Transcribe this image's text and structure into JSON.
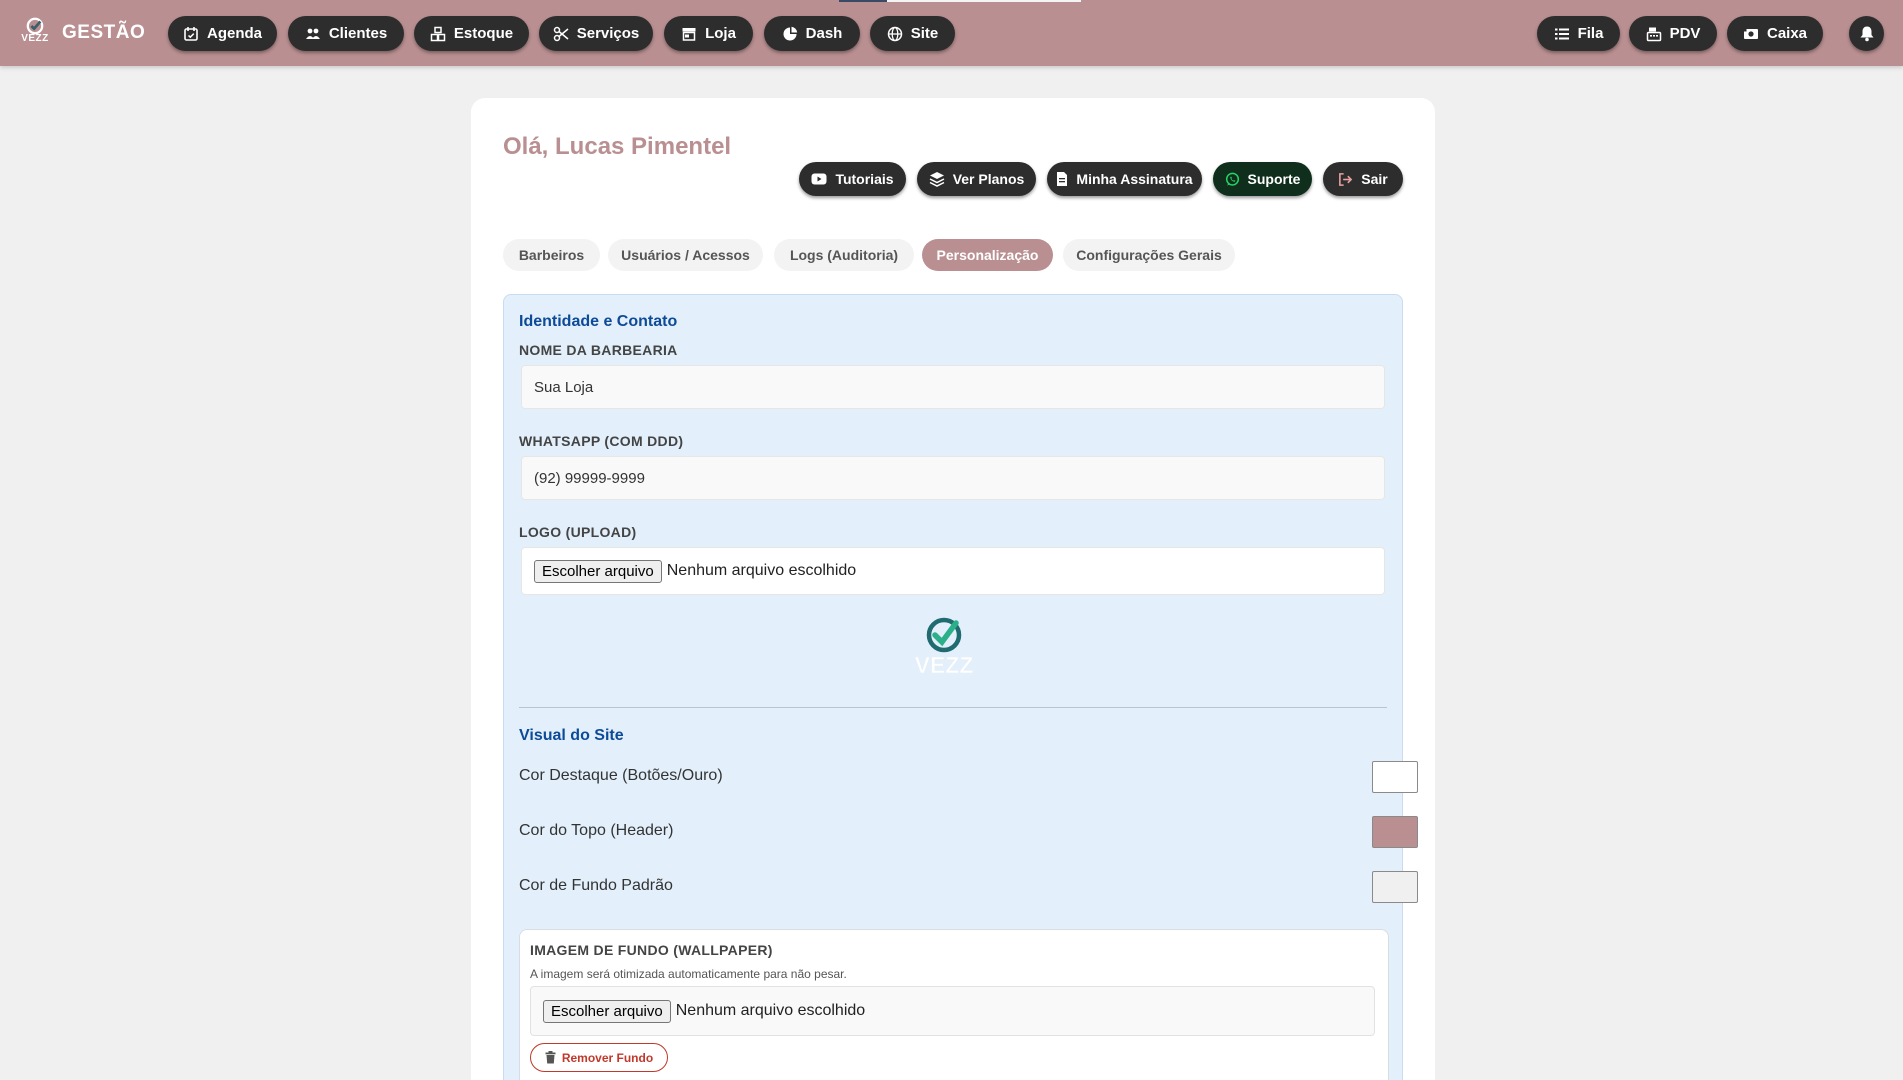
{
  "header": {
    "brand_small": "VEZZ",
    "title": "GESTÃO",
    "nav": [
      {
        "label": "Agenda",
        "icon": "calendar-icon"
      },
      {
        "label": "Clientes",
        "icon": "users-icon"
      },
      {
        "label": "Estoque",
        "icon": "boxes-icon"
      },
      {
        "label": "Serviços",
        "icon": "scissors-icon"
      },
      {
        "label": "Loja",
        "icon": "store-icon"
      },
      {
        "label": "Dash",
        "icon": "pie-chart-icon"
      },
      {
        "label": "Site",
        "icon": "globe-icon"
      }
    ],
    "right_nav": [
      {
        "label": "Fila",
        "icon": "list-icon"
      },
      {
        "label": "PDV",
        "icon": "cash-register-icon"
      },
      {
        "label": "Caixa",
        "icon": "money-icon"
      }
    ],
    "bell_icon": "bell-icon",
    "bg_color": "#b98f91"
  },
  "greeting": "Olá, Lucas Pimentel",
  "actions": [
    {
      "label": "Tutoriais",
      "icon": "youtube-icon"
    },
    {
      "label": "Ver Planos",
      "icon": "layers-icon"
    },
    {
      "label": "Minha Assinatura",
      "icon": "file-invoice-icon"
    },
    {
      "label": "Suporte",
      "icon": "whatsapp-icon"
    },
    {
      "label": "Sair",
      "icon": "logout-icon"
    }
  ],
  "tabs": [
    {
      "label": "Barbeiros",
      "active": false
    },
    {
      "label": "Usuários / Acessos",
      "active": false
    },
    {
      "label": "Logs (Auditoria)",
      "active": false
    },
    {
      "label": "Personalização",
      "active": true
    },
    {
      "label": "Configurações Gerais",
      "active": false
    }
  ],
  "identity": {
    "section_title": "Identidade e Contato",
    "name_label": "NOME DA BARBEARIA",
    "name_value": "Sua Loja",
    "whatsapp_label": "WHATSAPP (COM DDD)",
    "whatsapp_value": "(92) 99999-9999",
    "logo_label": "LOGO (UPLOAD)",
    "file_button": "Escolher arquivo",
    "file_status": "Nenhum arquivo escolhido",
    "logo_preview_text": "VEZZ"
  },
  "visual": {
    "section_title": "Visual do Site",
    "colors": [
      {
        "label": "Cor Destaque (Botões/Ouro)",
        "value": "#ffffff"
      },
      {
        "label": "Cor do Topo (Header)",
        "value": "#b98f91"
      },
      {
        "label": "Cor de Fundo Padrão",
        "value": "#f0f0f0"
      }
    ],
    "wallpaper": {
      "title": "IMAGEM DE FUNDO (WALLPAPER)",
      "hint": "A imagem será otimizada automaticamente para não pesar.",
      "file_button": "Escolher arquivo",
      "file_status": "Nenhum arquivo escolhido",
      "remove_label": "Remover Fundo"
    }
  }
}
